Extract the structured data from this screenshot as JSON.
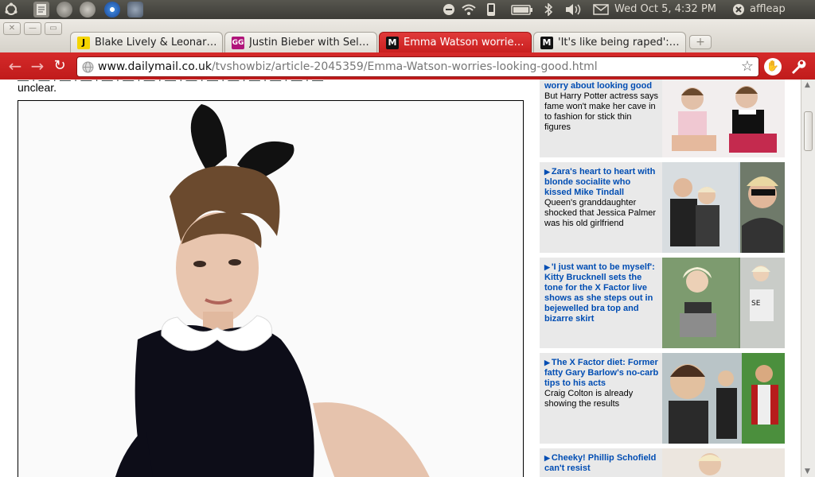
{
  "panel": {
    "clock": "Wed Oct  5,  4:32 PM",
    "user": "affleap",
    "icons": [
      "ubuntu-logo-icon",
      "text-editor-icon",
      "app-icon-1",
      "app-icon-2",
      "chromium-icon",
      "gimp-icon",
      "network-icon",
      "wifi-icon",
      "phone-icon",
      "battery-icon",
      "bluetooth-icon",
      "volume-icon",
      "mail-icon",
      "power-icon"
    ]
  },
  "window": {
    "buttons": [
      "close",
      "minimize",
      "maximize"
    ]
  },
  "tabs": [
    {
      "title": "Blake Lively & Leonar…",
      "favicon_text": "J",
      "favicon_bg": "#f4d400",
      "favicon_fg": "#000",
      "active": false
    },
    {
      "title": "Justin Bieber with Sel…",
      "favicon_text": "GG",
      "favicon_bg": "#b0147a",
      "favicon_fg": "#fff",
      "active": false
    },
    {
      "title": "Emma Watson worrie…",
      "favicon_text": "M",
      "favicon_bg": "#111",
      "favicon_fg": "#fff",
      "active": true
    },
    {
      "title": "'It's like being raped':…",
      "favicon_text": "M",
      "favicon_bg": "#111",
      "favicon_fg": "#fff",
      "active": false
    }
  ],
  "toolbar": {
    "url_host": "www.dailymail.co.uk",
    "url_path": "/tvshowbiz/article-2045359/Emma-Watson-worries-looking-good.html",
    "bookmark_icon": "star-icon",
    "accent": "#c91f1f"
  },
  "article": {
    "text_tail": "unclear."
  },
  "sidebar": {
    "items": [
      {
        "headline_top": "worry about looking good",
        "description": "But Harry Potter actress says fame won't make her cave in to fashion for stick thin figures"
      },
      {
        "headline": "Zara's heart to heart with blonde socialite who kissed Mike Tindall",
        "description": "Queen's granddaughter shocked that Jessica Palmer was his old girlfriend"
      },
      {
        "headline": "'I just want to be myself': Kitty Brucknell sets the tone for the X Factor live shows as she steps out in bejewelled bra top and bizarre skirt",
        "description": ""
      },
      {
        "headline": "The X Factor diet: Former fatty Gary Barlow's no-carb tips to his acts",
        "description": "Craig Colton is already showing the results"
      },
      {
        "headline": "Cheeky! Phillip Schofield can't resist",
        "description": ""
      }
    ]
  }
}
